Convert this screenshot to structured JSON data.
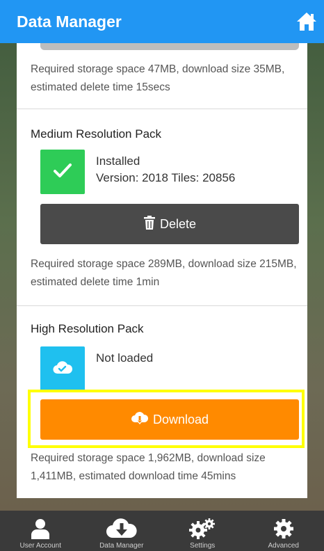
{
  "header": {
    "title": "Data Manager",
    "home_icon": "home-icon"
  },
  "packs": {
    "low": {
      "description": "Required storage space 47MB, download size 35MB, estimated delete time 15secs"
    },
    "medium": {
      "title": "Medium Resolution Pack",
      "status": "Installed",
      "version": "Version: 2018 Tiles: 20856",
      "button_label": "Delete",
      "button_icon": "trash-icon",
      "description": "Required storage space 289MB, download size 215MB, estimated delete time 1min"
    },
    "high": {
      "title": "High Resolution Pack",
      "status": "Not loaded",
      "button_label": "Download",
      "button_icon": "cloud-download-icon",
      "description": "Required storage space 1,962MB, download size 1,411MB, estimated download time 45mins"
    }
  },
  "bottom_nav": [
    {
      "label": "User Account",
      "icon": "user-icon"
    },
    {
      "label": "Data Manager",
      "icon": "cloud-download-icon"
    },
    {
      "label": "Settings",
      "icon": "gears-icon"
    },
    {
      "label": "Advanced",
      "icon": "gear-icon"
    }
  ],
  "colors": {
    "header": "#2196f3",
    "installed": "#2ecc57",
    "not_loaded": "#1fc0ef",
    "delete_button": "#4a4a4a",
    "download_button": "#ff8a00",
    "highlight": "#ffff00"
  }
}
